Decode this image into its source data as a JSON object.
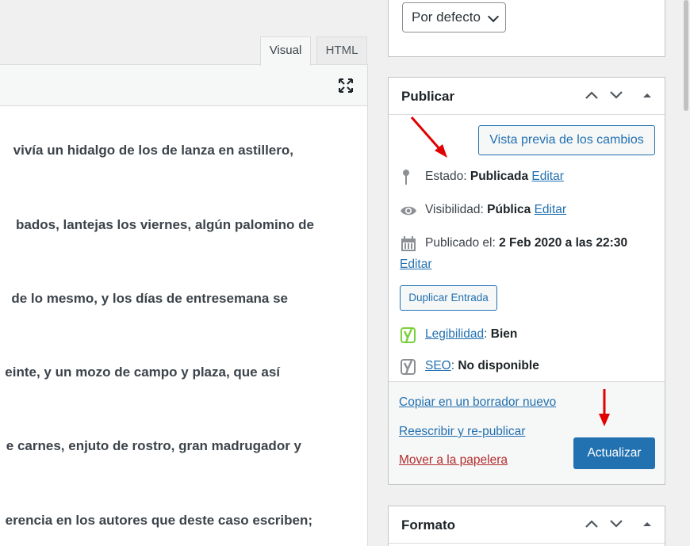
{
  "editor": {
    "tabs": [
      {
        "label": "Visual"
      },
      {
        "label": "HTML"
      }
    ],
    "paragraphs": [
      "vivía un hidalgo de los de lanza en astillero,",
      "bados, lantejas los viernes, algún palomino de",
      "de lo mesmo, y los días de entresemana se",
      "einte, y un mozo de campo y plaza, que así",
      "e carnes, enjuto de rostro, gran madrugador y",
      "erencia en los autores que deste caso escriben;"
    ]
  },
  "top_box": {
    "select_value": "Por defecto"
  },
  "publish": {
    "title": "Publicar",
    "preview_label": "Vista previa de los cambios",
    "status_label": "Estado:",
    "status_value": "Publicada",
    "edit_label": "Editar",
    "visibility_label": "Visibilidad:",
    "visibility_value": "Pública",
    "published_label": "Publicado el:",
    "published_value": "2 Feb 2020 a las 22:30",
    "duplicate_label": "Duplicar Entrada",
    "readability_label": "Legibilidad",
    "readability_value": "Bien",
    "seo_label": "SEO",
    "seo_value": "No disponible",
    "copy_draft_label": "Copiar en un borrador nuevo",
    "rewrite_label": "Reescribir y re-publicar",
    "trash_label": "Mover a la papelera",
    "update_label": "Actualizar"
  },
  "formato": {
    "title": "Formato"
  },
  "colors": {
    "accent": "#2271b1",
    "danger": "#b32d2e",
    "yoast_good": "#7ad03a",
    "yoast_na": "#888888",
    "annotation_arrow": "#e00000"
  }
}
